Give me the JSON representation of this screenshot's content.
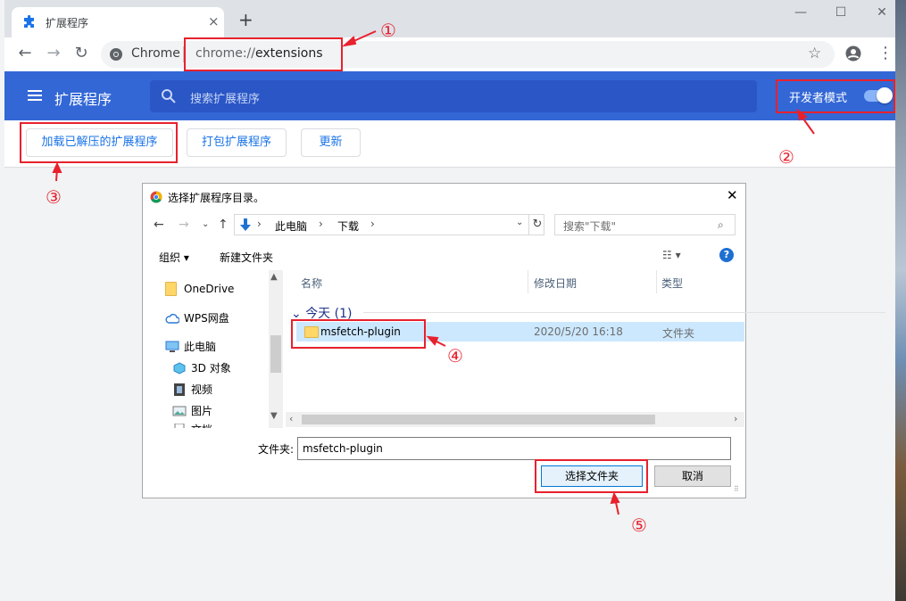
{
  "browser": {
    "tab_title": "扩展程序",
    "tab_close": "×",
    "new_tab": "+",
    "window_controls": {
      "minimize": "—",
      "maximize": "☐",
      "close": "✕"
    },
    "nav": {
      "back": "←",
      "forward": "→",
      "reload": "↻"
    },
    "omnibox": {
      "site": "Chrome",
      "url_scheme": "chrome://",
      "url_path": "extensions"
    },
    "icons": {
      "bookmark": "star-icon",
      "account": "account-icon",
      "menu": "kebab-menu-icon"
    }
  },
  "extensions_page": {
    "title": "扩展程序",
    "search_placeholder": "搜索扩展程序",
    "dev_mode_label": "开发者模式",
    "dev_mode_on": true,
    "actions": {
      "load_unpacked": "加载已解压的扩展程序",
      "pack": "打包扩展程序",
      "update": "更新"
    }
  },
  "dialog": {
    "title": "选择扩展程序目录。",
    "close": "✕",
    "breadcrumb": [
      "此电脑",
      "下载"
    ],
    "search_placeholder": "搜索\"下载\"",
    "commands": {
      "organize": "组织",
      "new_folder": "新建文件夹"
    },
    "nav_tree": [
      {
        "label": "OneDrive",
        "icon": "folder-icon"
      },
      {
        "label": "WPS网盘",
        "icon": "cloud-icon"
      },
      {
        "label": "此电脑",
        "icon": "computer-icon"
      },
      {
        "label": "3D 对象",
        "icon": "cube-icon"
      },
      {
        "label": "视频",
        "icon": "film-icon"
      },
      {
        "label": "图片",
        "icon": "picture-icon"
      },
      {
        "label": "文档",
        "icon": "document-icon"
      }
    ],
    "columns": {
      "name": "名称",
      "modified": "修改日期",
      "type": "类型"
    },
    "group_label": "今天 (1)",
    "files": [
      {
        "name": "msfetch-plugin",
        "modified": "2020/5/20 16:18",
        "type": "文件夹",
        "selected": true
      }
    ],
    "folder_label": "文件夹:",
    "folder_value": "msfetch-plugin",
    "select_button": "选择文件夹",
    "cancel_button": "取消"
  },
  "annotations": {
    "m1": "①",
    "m2": "②",
    "m3": "③",
    "m4": "④",
    "m5": "⑤"
  },
  "colors": {
    "header_blue": "#3367d6",
    "annotation_red": "#e8212d",
    "selection": "#cce8ff"
  }
}
